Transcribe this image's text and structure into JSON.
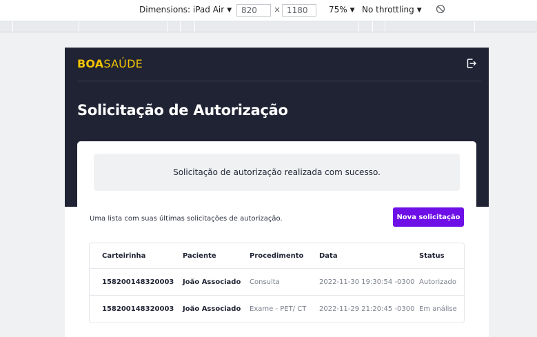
{
  "devtools": {
    "device_label": "Dimensions: iPad Air",
    "width": "820",
    "times": "×",
    "height": "1180",
    "zoom": "75%",
    "throttle": "No throttling"
  },
  "app": {
    "logo_bold": "BOA",
    "logo_rest": "SAÚDE",
    "page_title": "Solicitação de Autorização",
    "alert_message": "Solicitação de autorização realizada com sucesso.",
    "list_description": "Uma lista com suas últimas solicitações de autorização.",
    "new_request_label": "Nova solicitação",
    "table": {
      "headers": [
        "Carteirinha",
        "Paciente",
        "Procedimento",
        "Data",
        "Status"
      ],
      "rows": [
        [
          "158200148320003",
          "João Associado",
          "Consulta",
          "2022-11-30 19:30:54 -0300",
          "Autorizado"
        ],
        [
          "158200148320003",
          "João Associado",
          "Exame - PET/ CT",
          "2022-11-29 21:20:45 -0300",
          "Em análise"
        ]
      ]
    }
  },
  "colors": {
    "hero": "#1f2333",
    "accent": "#6d0fe6",
    "logo": "#f5c400"
  }
}
